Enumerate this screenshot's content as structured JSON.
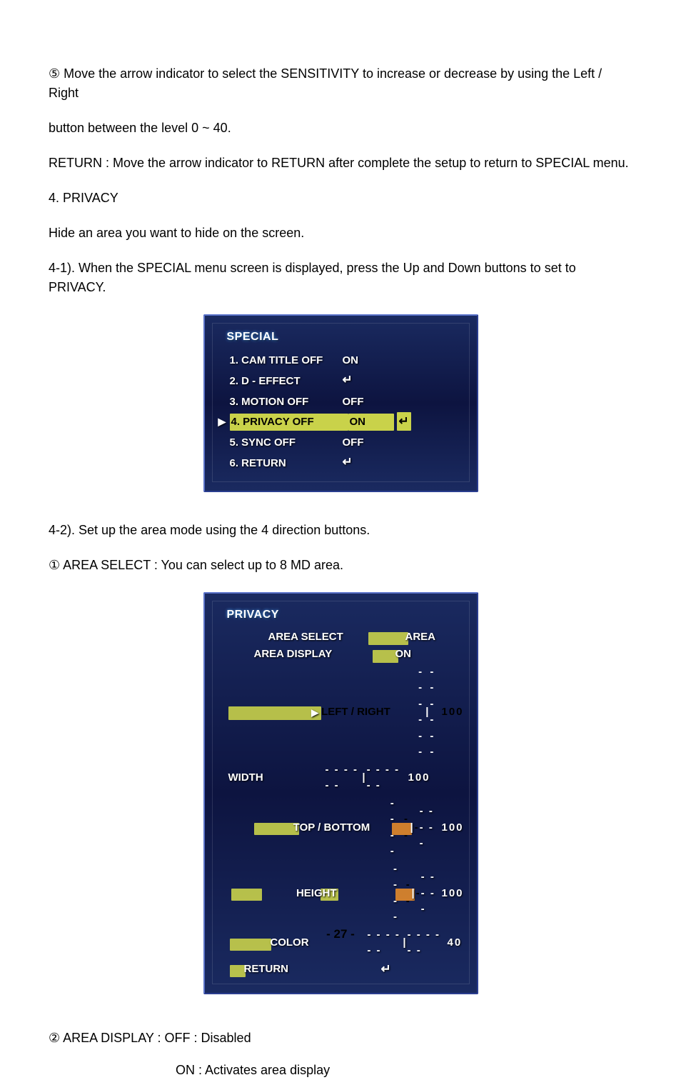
{
  "paragraphs": {
    "p1": "⑤  Move the arrow indicator to select the SENSITIVITY to increase or decrease by using the Left / Right",
    "p2": "button between the level 0 ~ 40.",
    "p3": "RETURN : Move the arrow indicator to RETURN after complete the setup to return to SPECIAL menu.",
    "p4": "4. PRIVACY",
    "p5": "Hide an area you want to hide on the screen.",
    "p6": "4-1). When the SPECIAL menu screen is displayed, press the Up and Down buttons to set to PRIVACY.",
    "p7": "4-2). Set up the area mode using the 4 direction buttons.",
    "p8": "①  AREA SELECT : You can select up to 8 MD area.",
    "p9": "②  AREA DISPLAY : OFF : Disabled",
    "p10": "ON : Activates area display"
  },
  "special": {
    "title": "SPECIAL",
    "rows": [
      {
        "label": "1. CAM TITLE OFF",
        "value": "ON",
        "enter": false,
        "selected": false
      },
      {
        "label": "2. D - EFFECT",
        "value": "↵",
        "enter": true,
        "selected": false
      },
      {
        "label": "3. MOTION OFF",
        "value": "OFF",
        "enter": false,
        "selected": false
      },
      {
        "label": "4. PRIVACY OFF",
        "value": "ON",
        "enter": true,
        "selected": true
      },
      {
        "label": "5. SYNC OFF",
        "value": "OFF",
        "enter": false,
        "selected": false
      },
      {
        "label": "6. RETURN",
        "value": "↵",
        "enter": true,
        "selected": false
      }
    ]
  },
  "privacy": {
    "title": "PRIVACY",
    "rows": [
      {
        "label": "AREA SELECT",
        "value": "AREA",
        "type": "text"
      },
      {
        "label": "AREA DISPLAY",
        "value": "ON",
        "type": "text"
      },
      {
        "label": "LEFT / RIGHT",
        "value": "100",
        "type": "slider",
        "selected": true
      },
      {
        "label": "WIDTH",
        "value": "100",
        "type": "slider"
      },
      {
        "label": "TOP / BOTTOM",
        "value": "100",
        "type": "slider"
      },
      {
        "label": "HEIGHT",
        "value": "100",
        "type": "slider"
      },
      {
        "label": "COLOR",
        "value": "40",
        "type": "slider"
      },
      {
        "label": "RETURN",
        "value": "↵",
        "type": "enter"
      }
    ]
  },
  "page_number": "- 27 -"
}
